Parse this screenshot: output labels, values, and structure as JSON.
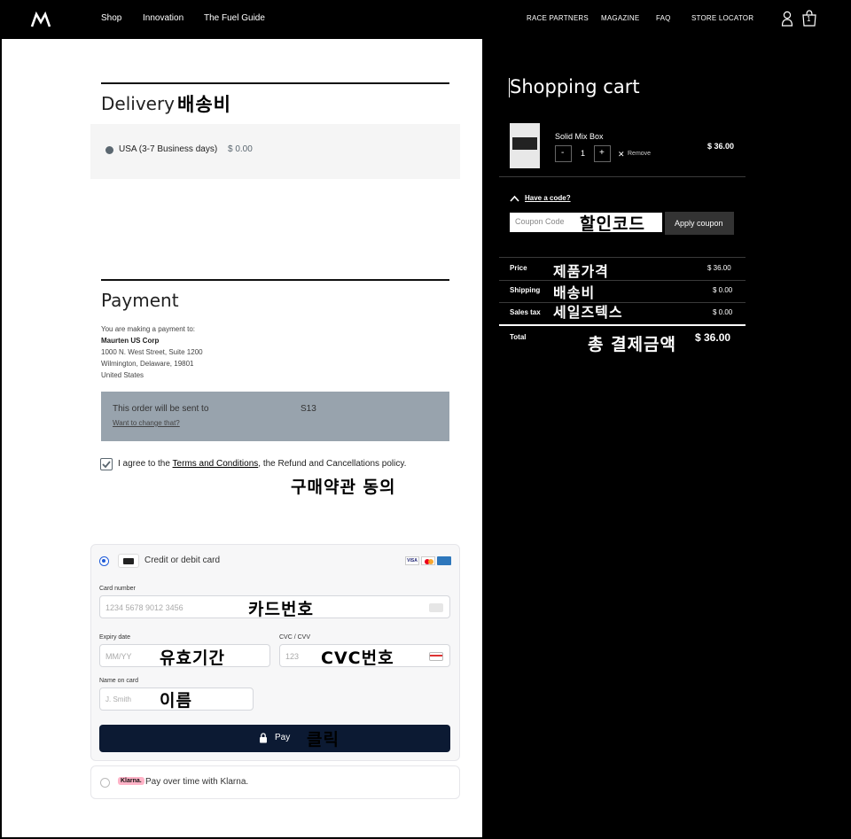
{
  "header": {
    "nav_left": [
      "Shop",
      "Innovation",
      "The Fuel Guide"
    ],
    "nav_right": [
      "RACE PARTNERS",
      "MAGAZINE",
      "FAQ",
      "STORE LOCATOR"
    ],
    "cart_count": "1"
  },
  "delivery": {
    "title": "Delivery",
    "annotation": "배송비",
    "option_label": "USA (3-7 Business days)",
    "option_price": "$ 0.00"
  },
  "payment": {
    "title": "Payment",
    "intro": "You are making a payment to:",
    "company": "Maurten US Corp",
    "address1": "1000 N. West Street, Suite 1200",
    "address2": "Wilmington, Delaware, 19801",
    "country": "United States",
    "sent_to_label": "This order will be sent to",
    "sent_to_value": "S13",
    "change_link": "Want to change that?",
    "agree_prefix": "I agree to the",
    "terms_link": "Terms and Conditions",
    "agree_suffix": ", the Refund and Cancellations policy.",
    "agree_annotation": "구매약관 동의"
  },
  "card_form": {
    "method_label": "Credit or debit card",
    "card_number_label": "Card number",
    "card_number_placeholder": "1234 5678 9012 3456",
    "card_number_annotation": "카드번호",
    "expiry_label": "Expiry date",
    "expiry_placeholder": "MM/YY",
    "expiry_annotation": "유효기간",
    "cvc_label": "CVC / CVV",
    "cvc_placeholder": "123",
    "cvc_annotation": "CVC번호",
    "name_label": "Name on card",
    "name_placeholder": "J. Smith",
    "name_annotation": "이름",
    "pay_label": "Pay",
    "pay_annotation": "클릭",
    "brands": [
      "VISA",
      "MC",
      "AMEX"
    ],
    "klarna_badge": "Klarna.",
    "klarna_label": "Pay over time with Klarna."
  },
  "cart": {
    "title": "Shopping cart",
    "item_name": "Solid Mix Box",
    "qty": "1",
    "minus": "-",
    "plus": "+",
    "remove": "Remove",
    "item_price": "$ 36.00",
    "have_code": "Have a code?",
    "coupon_placeholder": "Coupon Code",
    "coupon_annotation": "할인코드",
    "apply_label": "Apply coupon",
    "price_label": "Price",
    "price_annotation": "제품가격",
    "price_value": "$ 36.00",
    "shipping_label": "Shipping",
    "shipping_annotation": "배송비",
    "shipping_value": "$ 0.00",
    "tax_label": "Sales tax",
    "tax_annotation": "세일즈텍스",
    "tax_value": "$ 0.00",
    "total_label": "Total",
    "total_annotation": "총 결제금액",
    "total_value": "$ 36.00"
  },
  "colors": {
    "accent_navy": "#0c1a33",
    "sent_box": "#98a3ad",
    "radio_selected": "#1f5bd8"
  }
}
